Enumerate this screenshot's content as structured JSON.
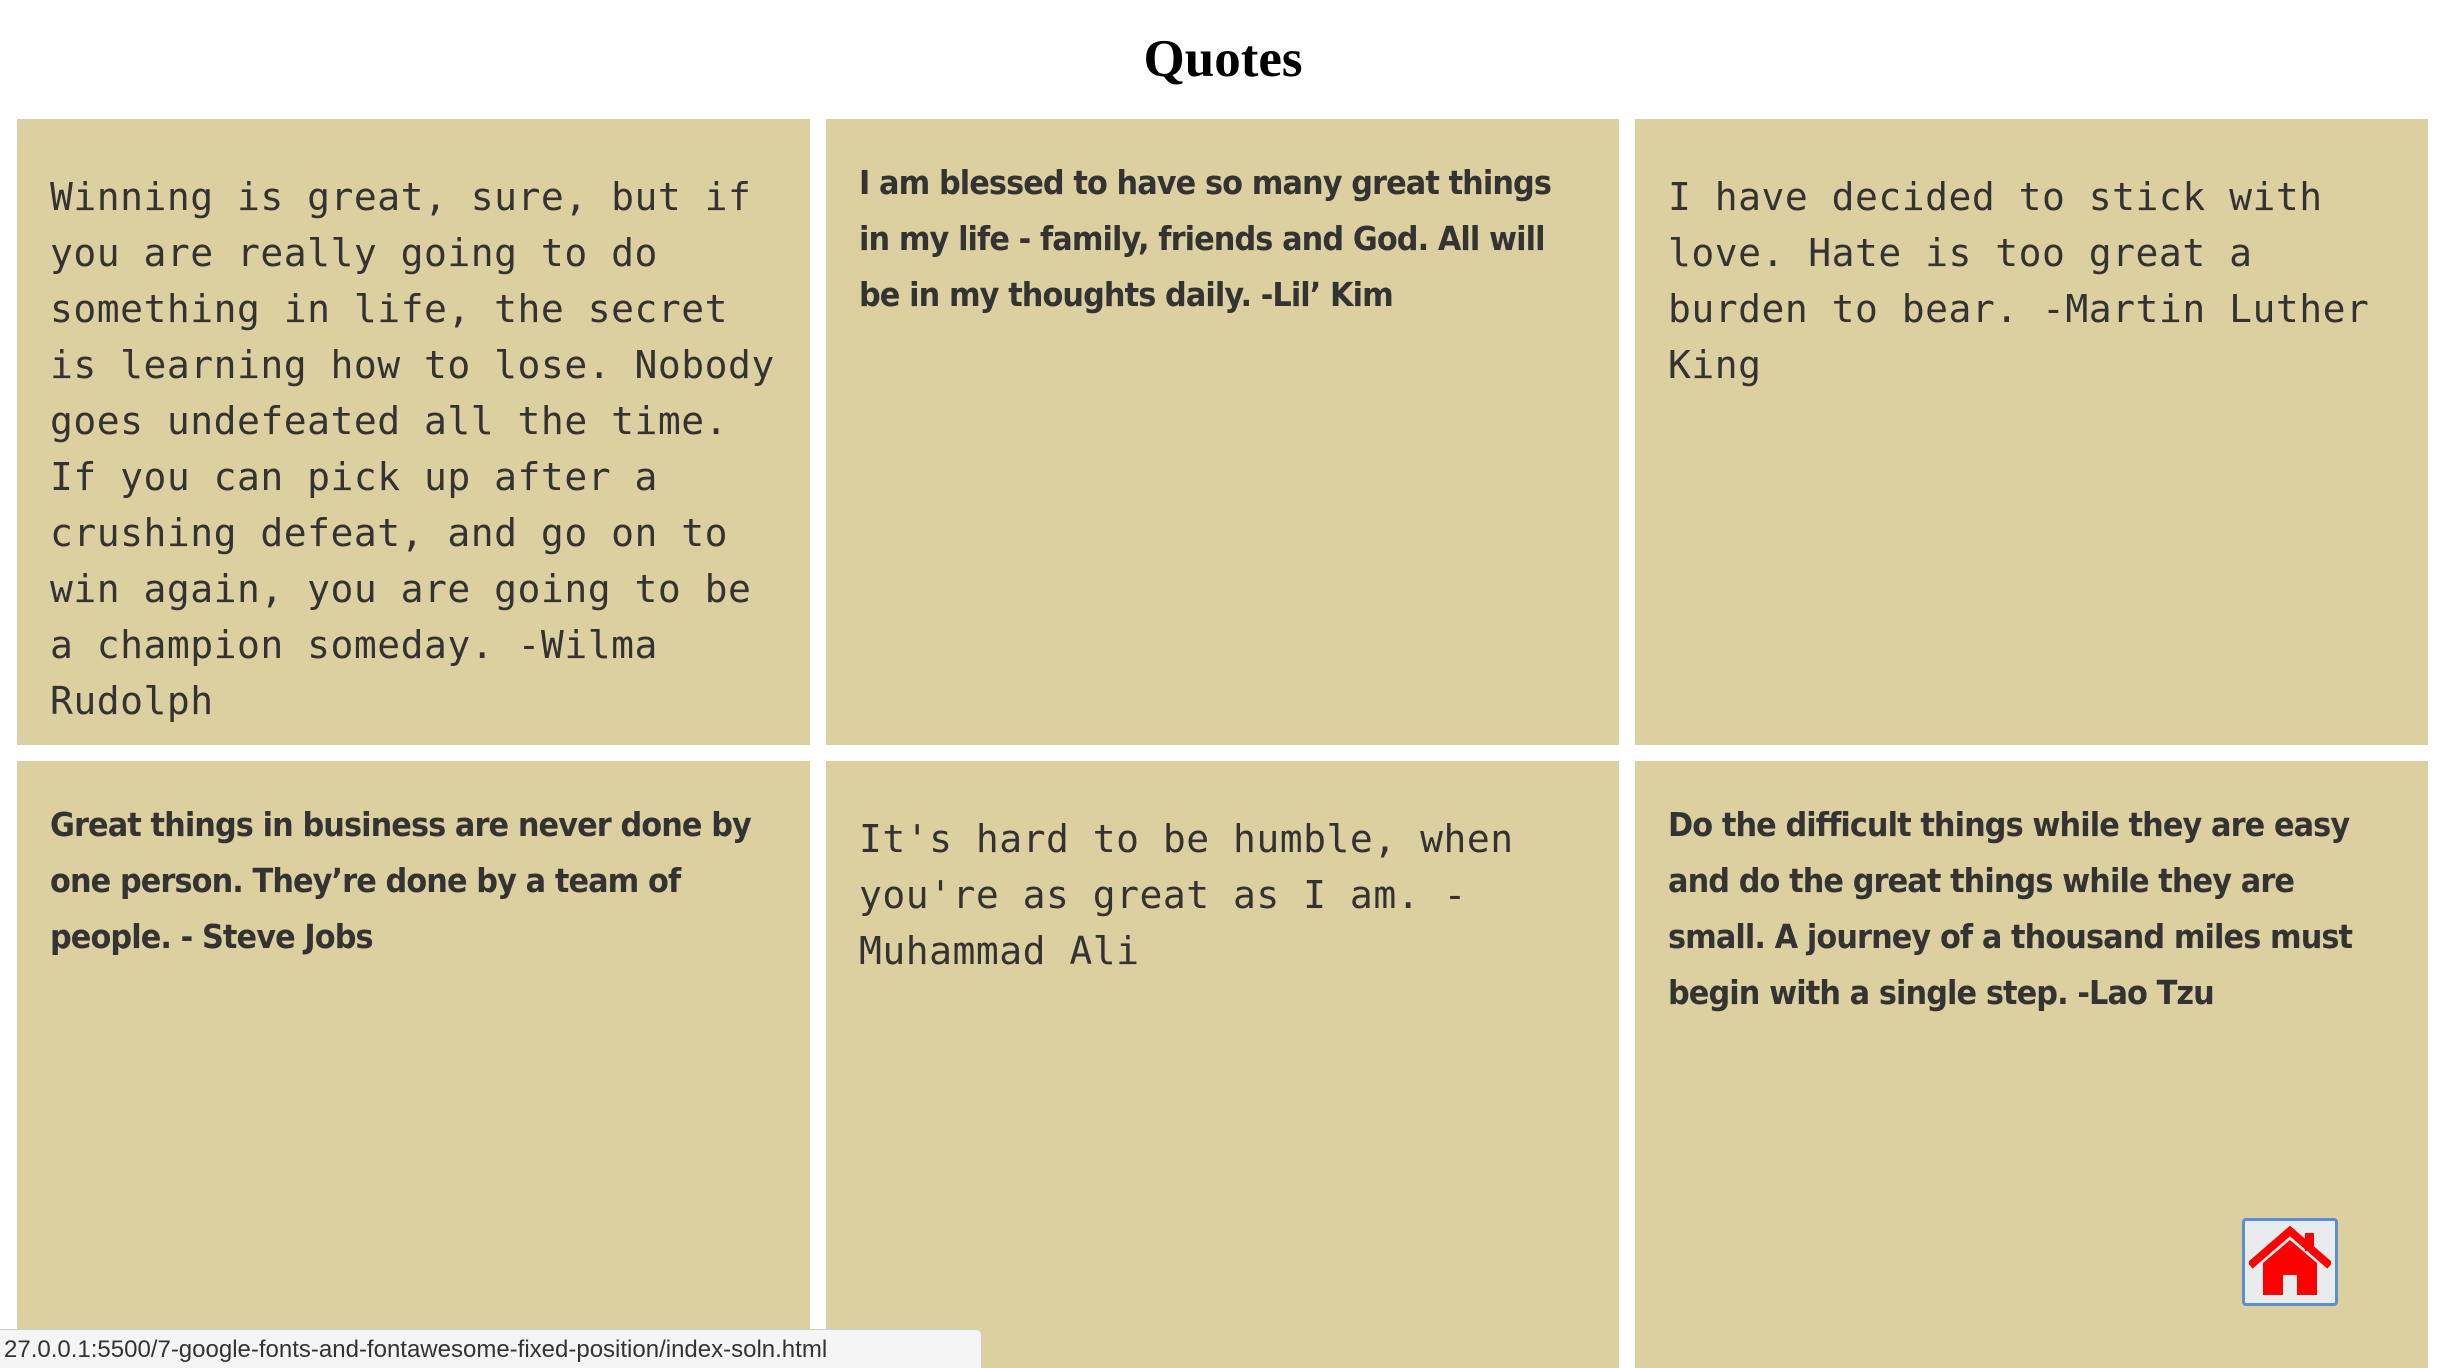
{
  "page": {
    "title": "Quotes"
  },
  "quotes": [
    {
      "text": "Winning is great, sure, but if you are really going to do something in life, the secret is learning how to lose. Nobody goes undefeated all the time. If you can pick up after a crushing defeat, and go on to win again, you are going to be a champion someday. -Wilma Rudolph"
    },
    {
      "text": "I am blessed to have so many great things in my life - family, friends and God. All will be in my thoughts daily. -Lil’ Kim"
    },
    {
      "text": "I have decided to stick with love. Hate is too great a burden to bear. -Martin Luther King"
    },
    {
      "text": "Great things in business are never done by one person. They’re done by a team of people. - Steve Jobs"
    },
    {
      "text": "It's hard to be humble, when you're as great as I am. - Muhammad Ali"
    },
    {
      "text": "Do the difficult things while they are easy and do the great things while they are small. A journey of a thousand miles must begin with a single step. -Lao Tzu"
    }
  ],
  "home_button": {
    "icon": "home-icon",
    "icon_color": "#ff0000"
  },
  "status_bar": {
    "url": "27.0.0.1:5500/7-google-fonts-and-fontawesome-fixed-position/index-soln.html"
  },
  "colors": {
    "card_background": "#ddd0a0",
    "text": "#333333"
  }
}
